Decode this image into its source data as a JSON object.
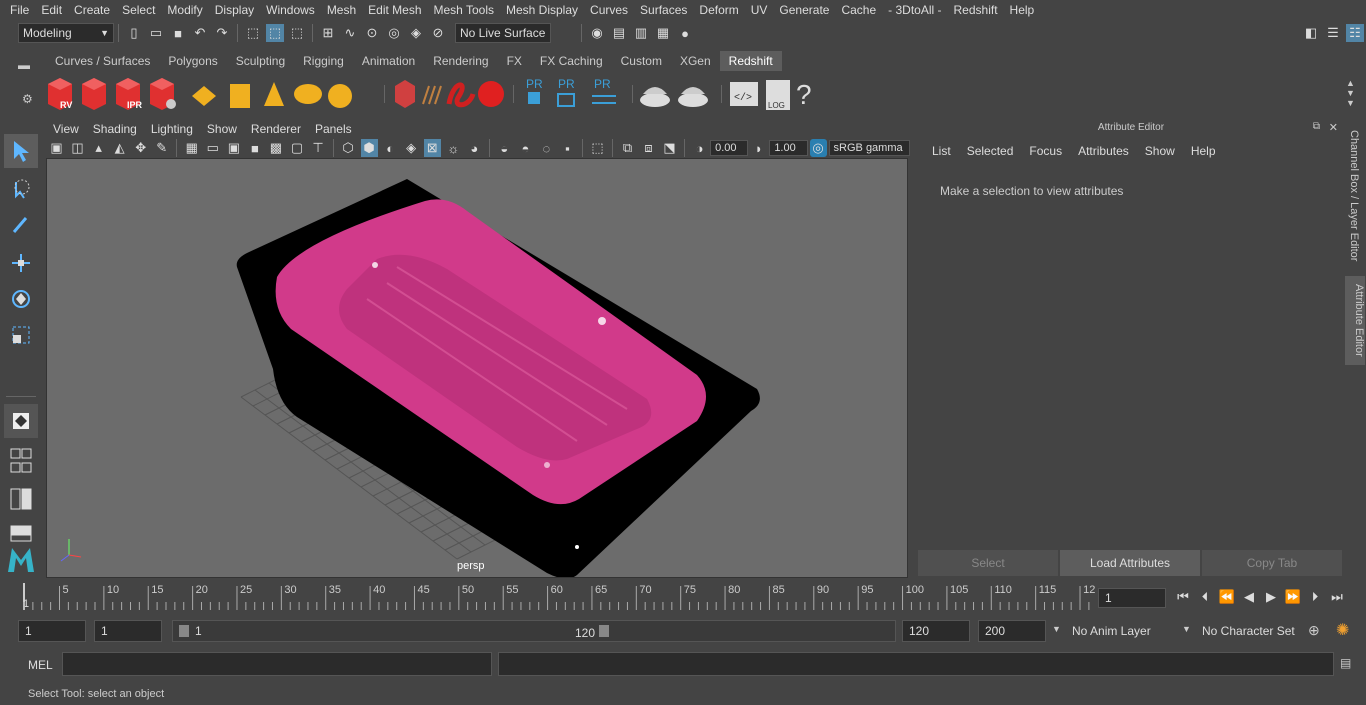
{
  "menu": [
    "File",
    "Edit",
    "Create",
    "Select",
    "Modify",
    "Display",
    "Windows",
    "Mesh",
    "Edit Mesh",
    "Mesh Tools",
    "Mesh Display",
    "Curves",
    "Surfaces",
    "Deform",
    "UV",
    "Generate",
    "Cache",
    "- 3DtoAll -",
    "Redshift",
    "Help"
  ],
  "toolbar": {
    "mode": "Modeling",
    "live_surface": "No Live Surface"
  },
  "shelf_tabs": [
    "Curves / Surfaces",
    "Polygons",
    "Sculpting",
    "Rigging",
    "Animation",
    "Rendering",
    "FX",
    "FX Caching",
    "Custom",
    "XGen",
    "Redshift"
  ],
  "shelf_active": "Redshift",
  "shelf_labels": {
    "rv": "RV",
    "ipr": "IPR",
    "pr": "PR",
    "log": "LOG",
    "help": "?"
  },
  "viewport": {
    "menu": [
      "View",
      "Shading",
      "Lighting",
      "Show",
      "Renderer",
      "Panels"
    ],
    "exposure": "0.00",
    "gamma": "1.00",
    "color_space": "sRGB gamma",
    "camera": "persp",
    "colors": {
      "bg": "#6c6c6c",
      "mesh": "#d13a8a",
      "tub": "#000000"
    }
  },
  "attribute_editor": {
    "title": "Attribute Editor",
    "menu": [
      "List",
      "Selected",
      "Focus",
      "Attributes",
      "Show",
      "Help"
    ],
    "message": "Make a selection to view attributes",
    "buttons": [
      "Select",
      "Load Attributes",
      "Copy Tab"
    ]
  },
  "side_tabs": {
    "channel": "Channel Box / Layer Editor",
    "attr": "Attribute Editor"
  },
  "timeline": {
    "ticks": [
      "5",
      "10",
      "15",
      "20",
      "25",
      "30",
      "35",
      "40",
      "45",
      "50",
      "55",
      "60",
      "65",
      "70",
      "75",
      "80",
      "85",
      "90",
      "95",
      "100",
      "105",
      "110",
      "115",
      "12"
    ],
    "start_label": "1",
    "current_frame": "1"
  },
  "range": {
    "start": "1",
    "playback_start": "1",
    "slider_start": "1",
    "slider_end": "120",
    "playback_end": "120",
    "end": "200",
    "anim_layer": "No Anim Layer",
    "character_set": "No Character Set"
  },
  "command": {
    "lang": "MEL"
  },
  "status": "Select Tool: select an object"
}
